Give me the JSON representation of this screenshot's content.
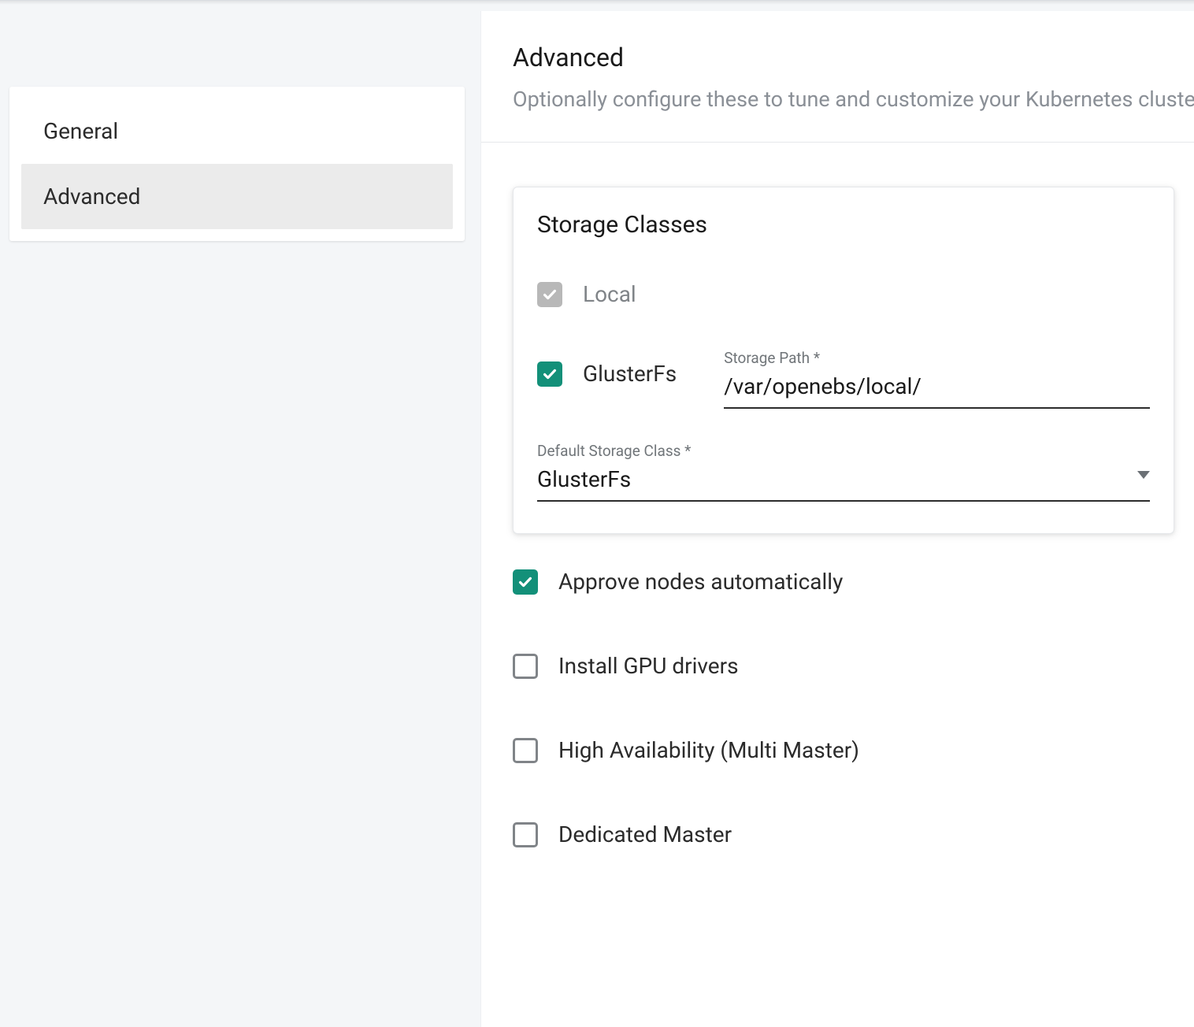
{
  "sidebar": {
    "items": [
      {
        "label": "General"
      },
      {
        "label": "Advanced"
      }
    ],
    "active_index": 1
  },
  "main": {
    "title": "Advanced",
    "subtitle": "Optionally configure these to tune and customize your Kubernetes cluster",
    "storage_card": {
      "title": "Storage Classes",
      "local": {
        "label": "Local",
        "checked": true,
        "disabled": true
      },
      "glusterfs": {
        "label": "GlusterFs",
        "checked": true
      },
      "storage_path": {
        "label": "Storage Path *",
        "value": "/var/openebs/local/"
      },
      "default_class": {
        "label": "Default Storage Class *",
        "value": "GlusterFs"
      }
    },
    "options": [
      {
        "label": "Approve nodes automatically",
        "checked": true
      },
      {
        "label": "Install GPU drivers",
        "checked": false
      },
      {
        "label": "High Availability (Multi Master)",
        "checked": false
      },
      {
        "label": "Dedicated Master",
        "checked": false
      }
    ]
  }
}
